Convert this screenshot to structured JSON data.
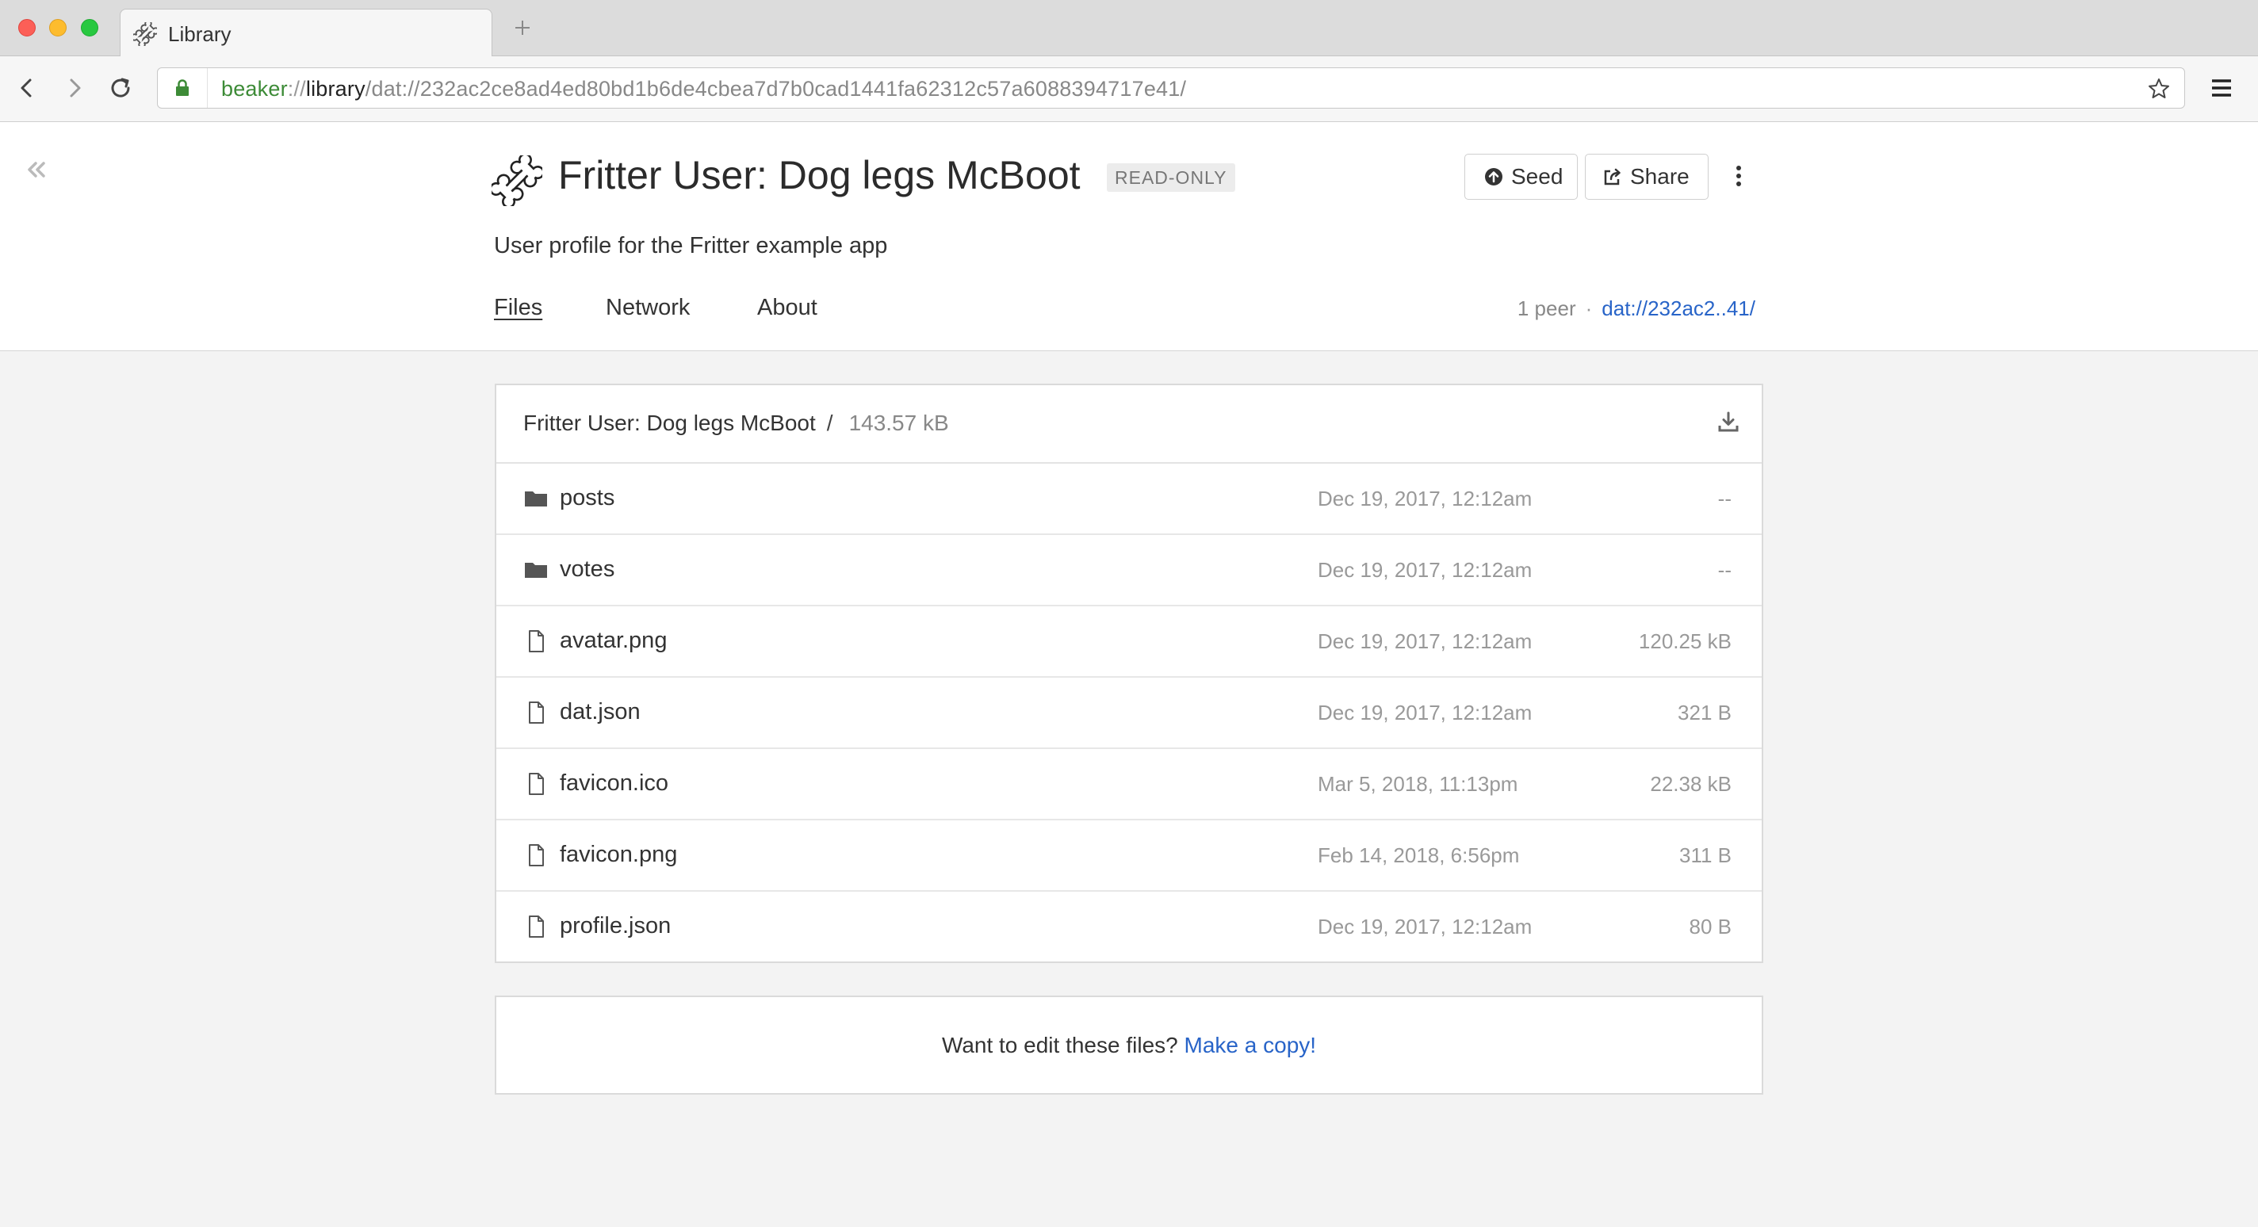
{
  "browser": {
    "tab_title": "Library",
    "url": {
      "scheme": "beaker",
      "separator": "://",
      "host": "library",
      "path": "/dat://232ac2ce8ad4ed80bd1b6de4cbea7d7b0cad1441fa62312c57a6088394717e41/"
    }
  },
  "header": {
    "title": "Fritter User: Dog legs McBoot",
    "badge": "READ-ONLY",
    "seed_label": "Seed",
    "share_label": "Share",
    "description": "User profile for the Fritter example app",
    "tabs": [
      {
        "label": "Files",
        "active": true
      },
      {
        "label": "Network",
        "active": false
      },
      {
        "label": "About",
        "active": false
      }
    ],
    "peer_count": "1 peer",
    "peer_separator": "·",
    "dat_link": "dat://232ac2..41/"
  },
  "files": {
    "breadcrumb": "Fritter User: Dog legs McBoot",
    "breadcrumb_sep": "/",
    "total_size": "143.57 kB",
    "rows": [
      {
        "name": "posts",
        "type": "folder",
        "date": "Dec 19, 2017, 12:12am",
        "size": "--"
      },
      {
        "name": "votes",
        "type": "folder",
        "date": "Dec 19, 2017, 12:12am",
        "size": "--"
      },
      {
        "name": "avatar.png",
        "type": "file",
        "date": "Dec 19, 2017, 12:12am",
        "size": "120.25 kB"
      },
      {
        "name": "dat.json",
        "type": "file",
        "date": "Dec 19, 2017, 12:12am",
        "size": "321 B"
      },
      {
        "name": "favicon.ico",
        "type": "file",
        "date": "Mar 5, 2018, 11:13pm",
        "size": "22.38 kB"
      },
      {
        "name": "favicon.png",
        "type": "file",
        "date": "Feb 14, 2018, 6:56pm",
        "size": "311 B"
      },
      {
        "name": "profile.json",
        "type": "file",
        "date": "Dec 19, 2017, 12:12am",
        "size": "80 B"
      }
    ]
  },
  "copy_prompt": {
    "text": "Want to edit these files?",
    "link": "Make a copy!"
  },
  "colors": {
    "link": "#2864c8",
    "secure_scheme": "#3d8b37",
    "muted": "#999999"
  },
  "icons": [
    "bone-icon",
    "lock-icon",
    "star-icon",
    "hamburger-menu-icon",
    "seed-upload-icon",
    "share-icon",
    "kebab-menu-icon",
    "download-icon",
    "folder-icon",
    "file-icon",
    "double-chevron-left-icon"
  ]
}
